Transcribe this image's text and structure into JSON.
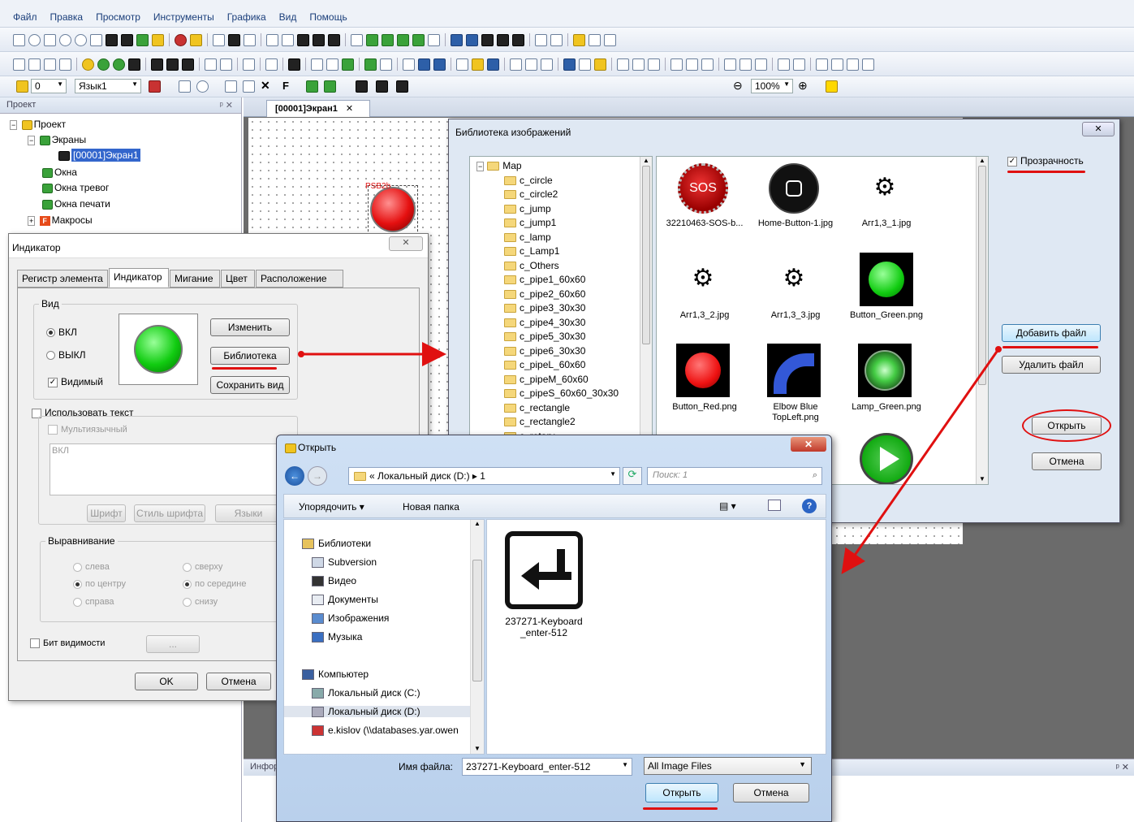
{
  "menu": [
    "Файл",
    "Правка",
    "Просмотр",
    "Инструменты",
    "Графика",
    "Вид",
    "Помощь"
  ],
  "toolbar": {
    "layer_value": "0",
    "language": "Язык1",
    "zoom": "100%"
  },
  "project_panel": {
    "title": "Проект",
    "tree": [
      {
        "label": "Проект",
        "level": 0
      },
      {
        "label": "Экраны",
        "level": 1
      },
      {
        "label": "[00001]Экран1",
        "level": 2,
        "selected": true
      },
      {
        "label": "Окна",
        "level": 1
      },
      {
        "label": "Окна тревог",
        "level": 1
      },
      {
        "label": "Окна печати",
        "level": 1
      },
      {
        "label": "Макросы",
        "level": 1
      }
    ]
  },
  "doc_tab": "[00001]Экран1",
  "canvas_label": "PSB2b",
  "info_panel_label": "Инфор",
  "indicator_dialog": {
    "title": "Индикатор",
    "tabs": [
      "Регистр элемента",
      "Индикатор",
      "Мигание",
      "Цвет",
      "Расположение"
    ],
    "view_group": "Вид",
    "on": "ВКЛ",
    "off": "ВЫКЛ",
    "visible": "Видимый",
    "btn_change": "Изменить",
    "btn_library": "Библиотека",
    "btn_save_view": "Сохранить вид",
    "use_text": "Использовать текст",
    "multilang": "Мультиязычный",
    "text_value": "ВКЛ",
    "btn_font": "Шрифт",
    "btn_font_style": "Стиль шрифта",
    "btn_languages": "Языки",
    "align_group": "Выравнивание",
    "align_left": "слева",
    "align_center": "по центру",
    "align_right": "справа",
    "align_top": "сверху",
    "align_middle": "по середине",
    "align_bottom": "снизу",
    "visibility_bit": "Бит видимости",
    "dots": "...",
    "ok": "OK",
    "cancel": "Отмена"
  },
  "library_dialog": {
    "title": "Библиотека изображений",
    "close": "✕",
    "folders": [
      "Map",
      "c_circle",
      "c_circle2",
      "c_jump",
      "c_jump1",
      "c_lamp",
      "c_Lamp1",
      "c_Others",
      "c_pipe1_60x60",
      "c_pipe2_60x60",
      "c_pipe3_30x30",
      "c_pipe4_30x30",
      "c_pipe5_30x30",
      "c_pipe6_30x30",
      "c_pipeL_60x60",
      "c_pipeM_60x60",
      "c_pipeS_60x60_30x30",
      "c_rectangle",
      "c_rectangle2",
      "c_rotary"
    ],
    "images": [
      "32210463-SOS-b...",
      "Home-Button-1.jpg",
      "Агг1,3_1.jpg",
      "Агг1,3_2.jpg",
      "Агг1,3_3.jpg",
      "Button_Green.png",
      "Button_Red.png",
      "Elbow Blue TopLeft.png",
      "Lamp_Green.png"
    ],
    "sos_text": "SOS",
    "transparency": "Прозрачность",
    "add_file": "Добавить файл",
    "delete_file": "Удалить файл",
    "open": "Открыть",
    "cancel": "Отмена"
  },
  "open_dialog": {
    "title": "Открыть",
    "path_prefix": "«",
    "path": "Локальный диск (D:)",
    "path_child": "1",
    "search_placeholder": "Поиск: 1",
    "organize": "Упорядочить ▾",
    "new_folder": "Новая папка",
    "nav": [
      "Библиотеки",
      "Subversion",
      "Видео",
      "Документы",
      "Изображения",
      "Музыка",
      "Компьютер",
      "Локальный диск (C:)",
      "Локальный диск (D:)",
      "e.kislov (\\\\databases.yar.owen"
    ],
    "file_name": "237271-Keyboard_enter-512",
    "file_label": "Имя файла:",
    "file_value": "237271-Keyboard_enter-512",
    "file_type": "All Image Files",
    "open": "Открыть",
    "cancel": "Отмена"
  },
  "colors": {
    "accent_red": "#e01010",
    "selection": "#3366cc",
    "dark_bg": "#6b6b6b"
  }
}
